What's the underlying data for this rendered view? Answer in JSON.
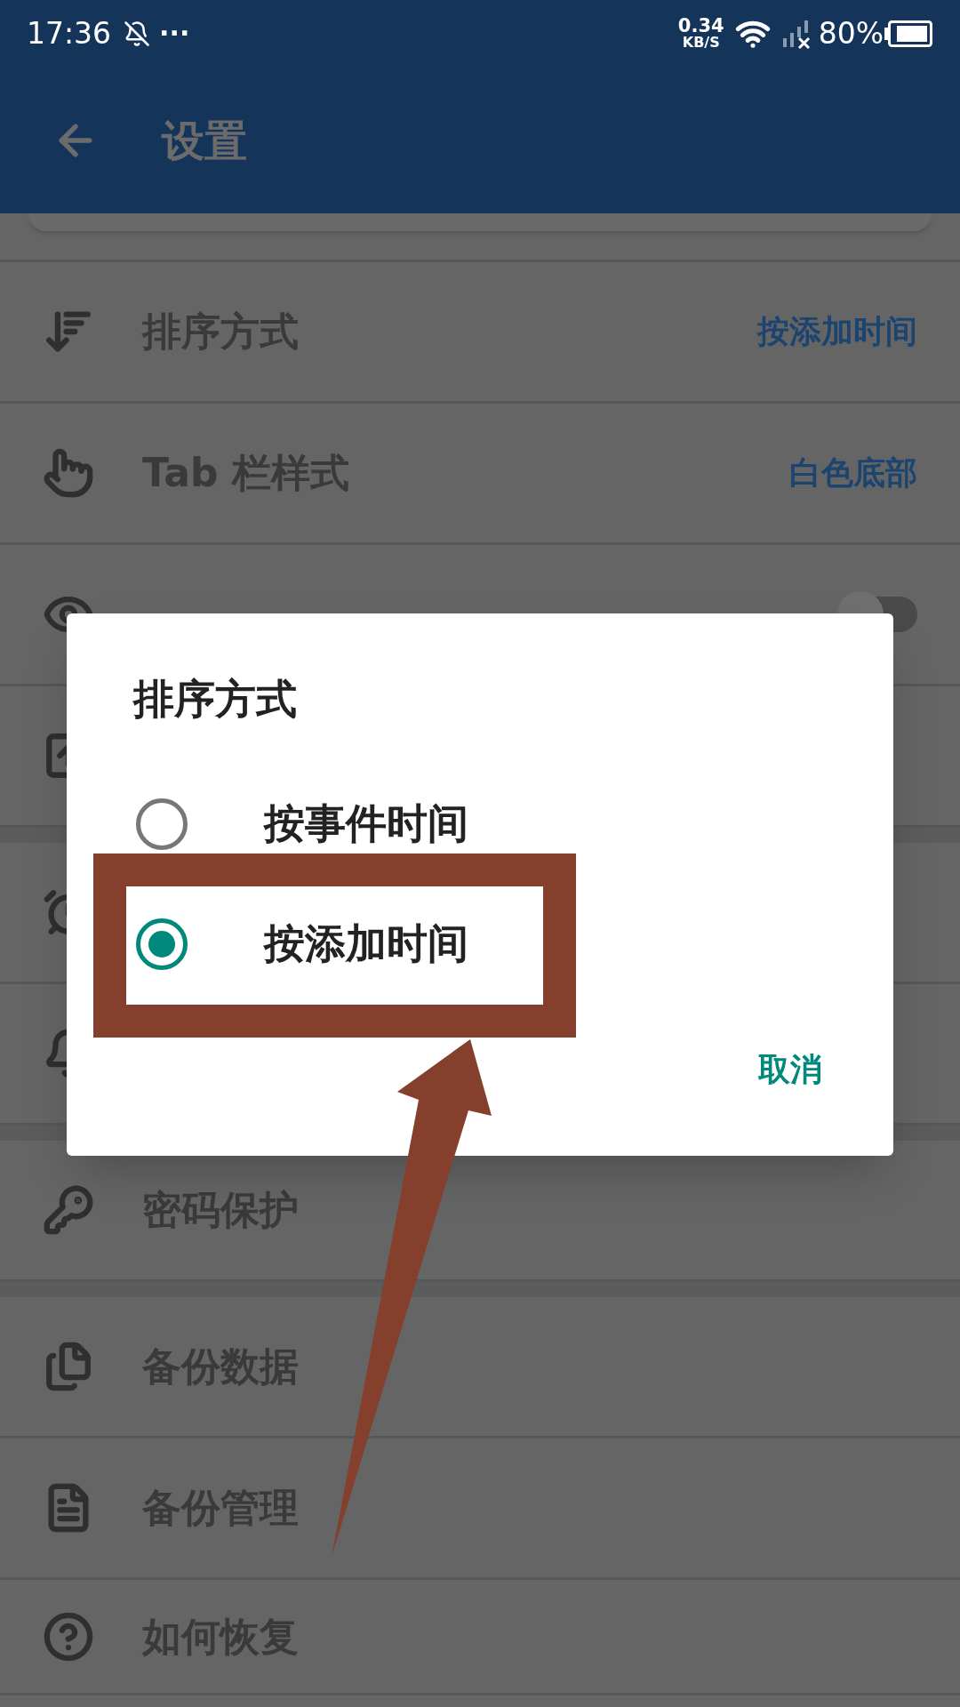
{
  "status_bar": {
    "time": "17:36",
    "more": "···",
    "net_speed": "0.34",
    "net_unit": "KB/S",
    "battery": "80%"
  },
  "header": {
    "title": "设置"
  },
  "groups": [
    [
      {
        "kind": "value",
        "label": "排序方式",
        "value": "按添加时间"
      },
      {
        "kind": "value",
        "label": "Tab 栏样式",
        "value": "白色底部"
      },
      {
        "kind": "toggle",
        "on": false
      },
      {
        "kind": "bare"
      }
    ],
    [
      {
        "kind": "bare"
      },
      {
        "kind": "bare"
      }
    ],
    [
      {
        "kind": "plain",
        "label": "密码保护"
      }
    ],
    [
      {
        "kind": "plain",
        "label": "备份数据"
      },
      {
        "kind": "plain",
        "label": "备份管理"
      },
      {
        "kind": "plain",
        "label": "如何恢复"
      }
    ]
  ],
  "dialog": {
    "title": "排序方式",
    "options": [
      {
        "label": "按事件时间",
        "selected": false
      },
      {
        "label": "按添加时间",
        "selected": true
      }
    ],
    "cancel": "取消"
  }
}
